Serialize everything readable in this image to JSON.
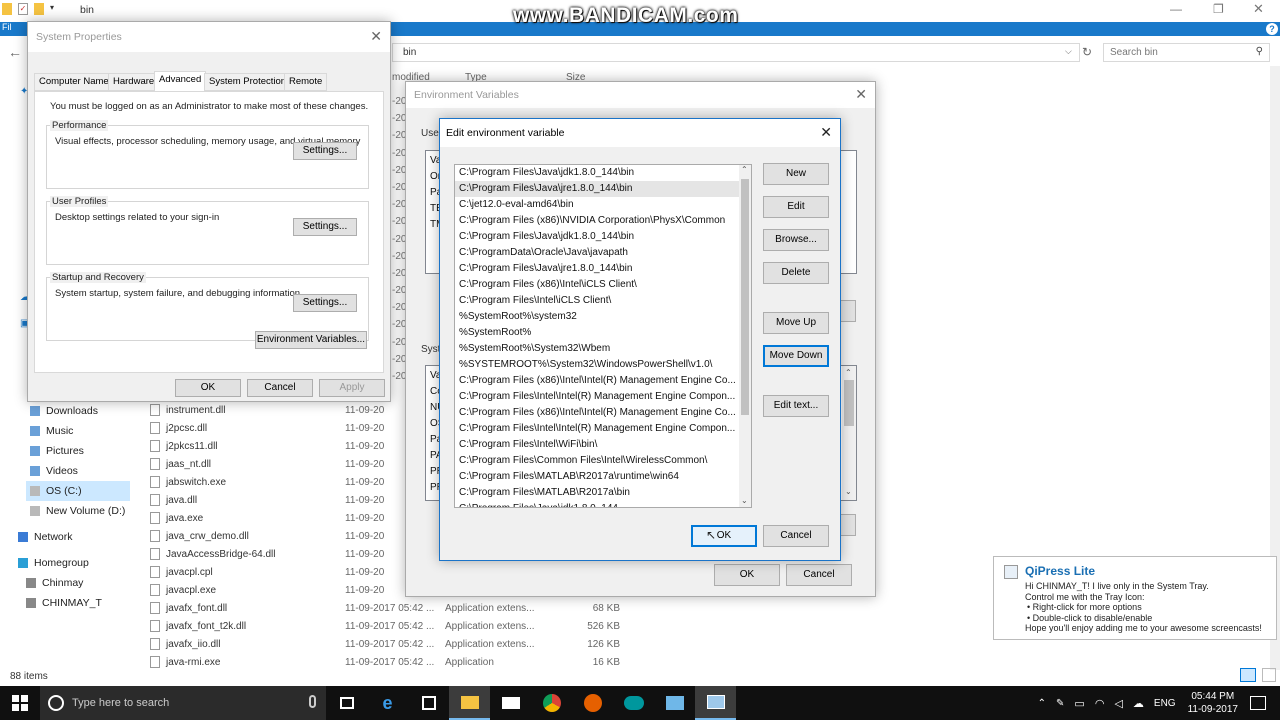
{
  "watermark": "www.BANDICAM.com",
  "explorer": {
    "path": "bin",
    "address": "bin",
    "search_placeholder": "Search bin",
    "col_modified": "modified",
    "col_type": "Type",
    "col_size": "Size",
    "dates_partial": [
      "-20",
      "-20",
      "-20",
      "-20",
      "-20",
      "-20",
      "-20",
      "-20",
      "-20",
      "-20",
      "-20",
      "-20",
      "-20",
      "-20",
      "-20",
      "-20",
      "-20"
    ],
    "nav": [
      {
        "label": "Downloads",
        "icon": "download-icon"
      },
      {
        "label": "Music",
        "icon": "music-icon"
      },
      {
        "label": "Pictures",
        "icon": "pictures-icon"
      },
      {
        "label": "Videos",
        "icon": "videos-icon"
      },
      {
        "label": "OS (C:)",
        "icon": "drive-icon"
      },
      {
        "label": "New Volume (D:)",
        "icon": "drive-icon"
      },
      {
        "label": "Network",
        "icon": "network-icon"
      },
      {
        "label": "Homegroup",
        "icon": "homegroup-icon"
      },
      {
        "label": "Chinmay",
        "icon": "user-icon"
      },
      {
        "label": "CHINMAY_T",
        "icon": "computer-icon"
      }
    ],
    "files": [
      {
        "name": "instrument.dll",
        "date": "11-09-20",
        "type": "",
        "size": ""
      },
      {
        "name": "j2pcsc.dll",
        "date": "11-09-20",
        "type": "",
        "size": ""
      },
      {
        "name": "j2pkcs11.dll",
        "date": "11-09-20",
        "type": "",
        "size": ""
      },
      {
        "name": "jaas_nt.dll",
        "date": "11-09-20",
        "type": "",
        "size": ""
      },
      {
        "name": "jabswitch.exe",
        "date": "11-09-20",
        "type": "",
        "size": ""
      },
      {
        "name": "java.dll",
        "date": "11-09-20",
        "type": "",
        "size": ""
      },
      {
        "name": "java.exe",
        "date": "11-09-20",
        "type": "",
        "size": ""
      },
      {
        "name": "java_crw_demo.dll",
        "date": "11-09-20",
        "type": "",
        "size": ""
      },
      {
        "name": "JavaAccessBridge-64.dll",
        "date": "11-09-20",
        "type": "",
        "size": ""
      },
      {
        "name": "javacpl.cpl",
        "date": "11-09-20",
        "type": "",
        "size": ""
      },
      {
        "name": "javacpl.exe",
        "date": "11-09-20",
        "type": "",
        "size": ""
      },
      {
        "name": "javafx_font.dll",
        "date": "11-09-2017 05:42 ...",
        "type": "Application extens...",
        "size": "68 KB"
      },
      {
        "name": "javafx_font_t2k.dll",
        "date": "11-09-2017 05:42 ...",
        "type": "Application extens...",
        "size": "526 KB"
      },
      {
        "name": "javafx_iio.dll",
        "date": "11-09-2017 05:42 ...",
        "type": "Application extens...",
        "size": "126 KB"
      },
      {
        "name": "java-rmi.exe",
        "date": "11-09-2017 05:42 ...",
        "type": "Application",
        "size": "16 KB"
      }
    ],
    "status": "88 items"
  },
  "sysprops": {
    "title": "System Properties",
    "tabs": [
      "Computer Name",
      "Hardware",
      "Advanced",
      "System Protection",
      "Remote"
    ],
    "admin_note": "You must be logged on as an Administrator to make most of these changes.",
    "perf_title": "Performance",
    "perf_desc": "Visual effects, processor scheduling, memory usage, and virtual memory",
    "profiles_title": "User Profiles",
    "profiles_desc": "Desktop settings related to your sign-in",
    "startup_title": "Startup and Recovery",
    "startup_desc": "System startup, system failure, and debugging information",
    "settings_label": "Settings...",
    "env_btn": "Environment Variables...",
    "ok": "OK",
    "cancel": "Cancel",
    "apply": "Apply"
  },
  "envvars": {
    "title": "Environment Variables",
    "user_label": "User",
    "sys_label": "Syste",
    "user_rows": [
      "Va",
      "On",
      "Pa",
      "TE",
      "TM"
    ],
    "sys_rows": [
      "Va",
      "Co",
      "NU",
      "OS",
      "Pa",
      "PA",
      "PR",
      "PR"
    ],
    "ok": "OK",
    "cancel": "Cancel"
  },
  "editvar": {
    "title": "Edit environment variable",
    "entries": [
      "C:\\Program Files\\Java\\jdk1.8.0_144\\bin",
      "C:\\Program Files\\Java\\jre1.8.0_144\\bin",
      "C:\\jet12.0-eval-amd64\\bin",
      "C:\\Program Files (x86)\\NVIDIA Corporation\\PhysX\\Common",
      "C:\\Program Files\\Java\\jdk1.8.0_144\\bin",
      "C:\\ProgramData\\Oracle\\Java\\javapath",
      "C:\\Program Files\\Java\\jre1.8.0_144\\bin",
      "C:\\Program Files (x86)\\Intel\\iCLS Client\\",
      "C:\\Program Files\\Intel\\iCLS Client\\",
      "%SystemRoot%\\system32",
      "%SystemRoot%",
      "%SystemRoot%\\System32\\Wbem",
      "%SYSTEMROOT%\\System32\\WindowsPowerShell\\v1.0\\",
      "C:\\Program Files (x86)\\Intel\\Intel(R) Management Engine Co...",
      "C:\\Program Files\\Intel\\Intel(R) Management Engine Compon...",
      "C:\\Program Files (x86)\\Intel\\Intel(R) Management Engine Co...",
      "C:\\Program Files\\Intel\\Intel(R) Management Engine Compon...",
      "C:\\Program Files\\Intel\\WiFi\\bin\\",
      "C:\\Program Files\\Common Files\\Intel\\WirelessCommon\\",
      "C:\\Program Files\\MATLAB\\R2017a\\runtime\\win64",
      "C:\\Program Files\\MATLAB\\R2017a\\bin",
      "C:\\Program Files\\Java\\jdk1.8.0_144"
    ],
    "btn_new": "New",
    "btn_edit": "Edit",
    "btn_browse": "Browse...",
    "btn_delete": "Delete",
    "btn_up": "Move Up",
    "btn_down": "Move Down",
    "btn_edittext": "Edit text...",
    "ok": "OK",
    "cancel": "Cancel"
  },
  "toast": {
    "title": "QiPress Lite",
    "line1": "Hi CHINMAY_T! I live only in the System Tray.",
    "line2": "Control me with the Tray Icon:",
    "line3": "• Right-click for more options",
    "line4": "• Double-click to disable/enable",
    "line5": "Hope you'll enjoy adding me to your awesome screencasts!"
  },
  "taskbar": {
    "search_placeholder": "Type here to search",
    "lang": "ENG",
    "time": "05:44 PM",
    "date": "11-09-2017"
  },
  "colors": {
    "accent": "#0078d7",
    "ribbon": "#1979ca",
    "taskbar": "#101010",
    "toast_title": "#1a6fb3"
  }
}
